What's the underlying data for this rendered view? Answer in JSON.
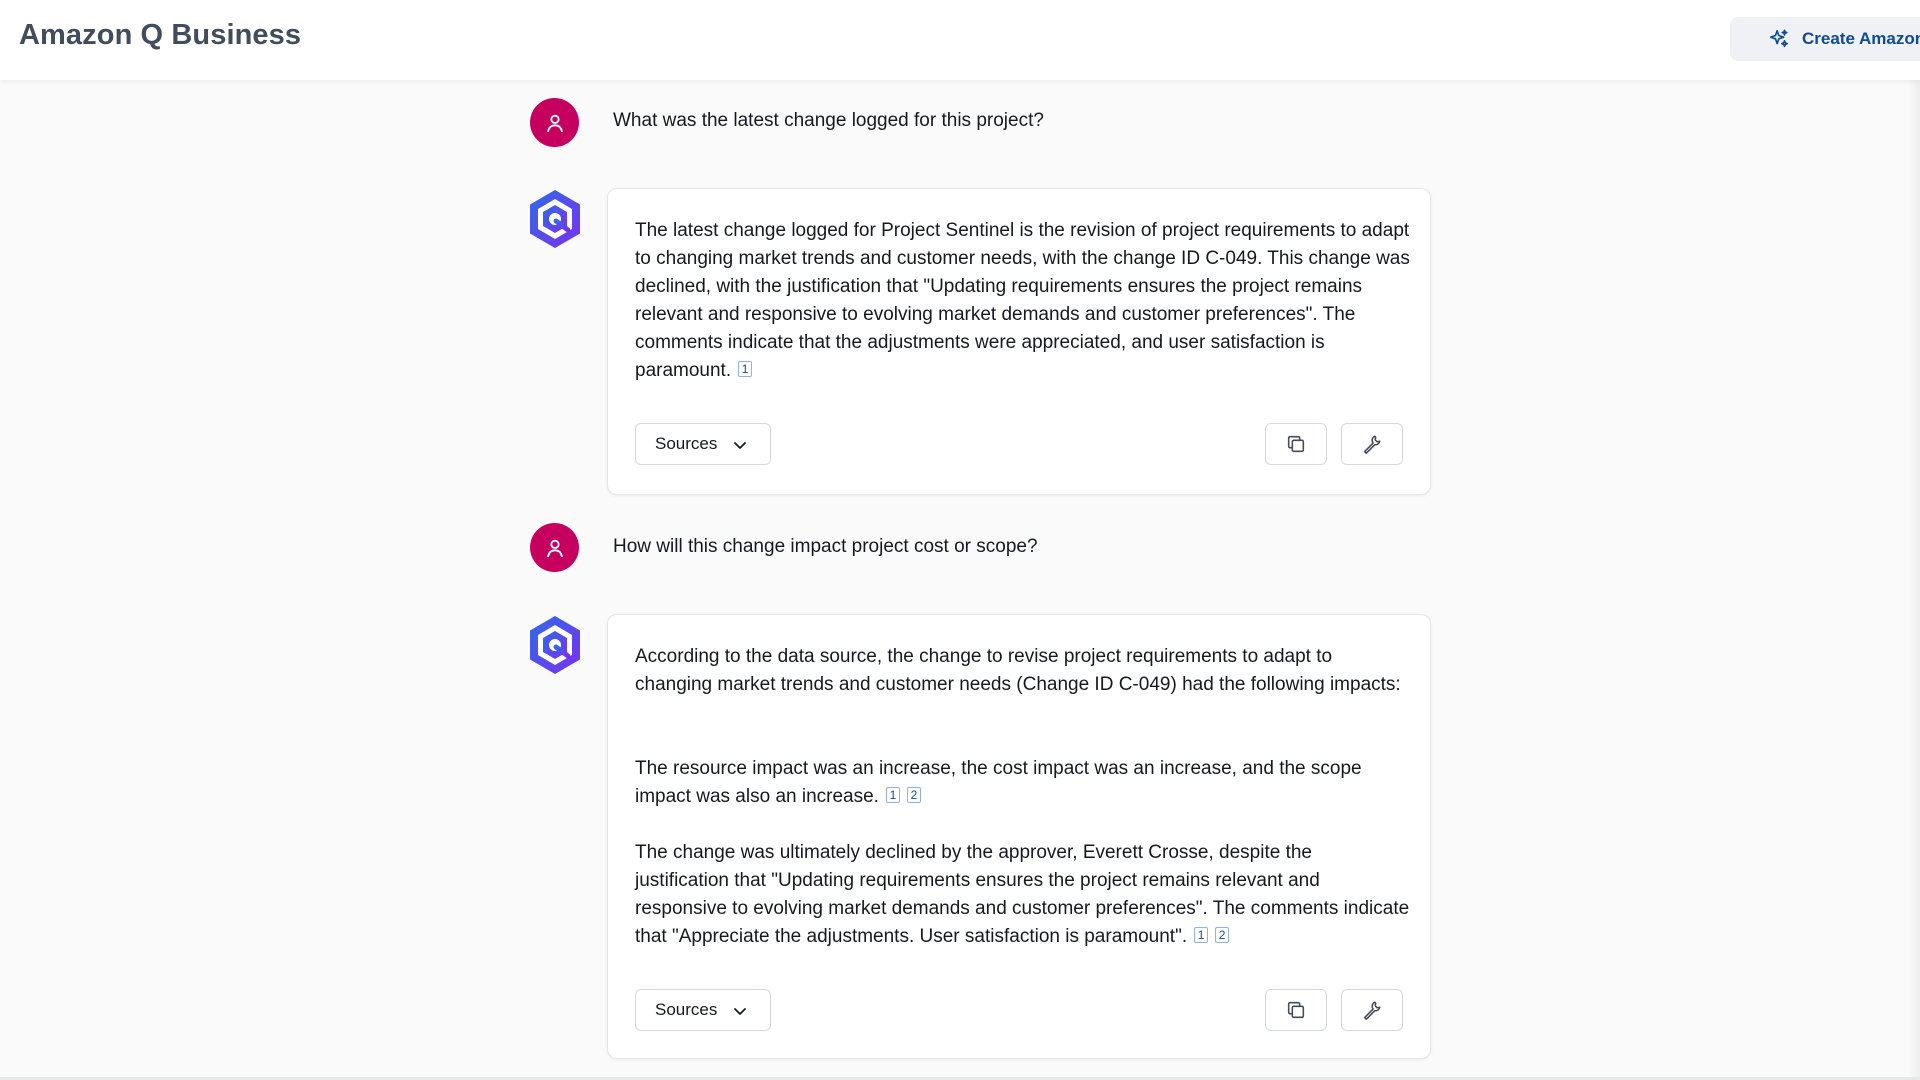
{
  "header": {
    "title": "Amazon Q Business",
    "create_button_label": "Create Amazon"
  },
  "conversation": [
    {
      "question": "What was the latest change logged for this project?",
      "answer_paragraphs": [
        {
          "text": "The latest change logged for Project Sentinel is the revision of project requirements to adapt to changing market trends and customer needs, with the change ID C-049. This change was declined, with the justification that \"Updating requirements ensures the project remains relevant and responsive to evolving market demands and customer preferences\". The comments indicate that the adjustments were appreciated, and user satisfaction is paramount.",
          "citations": [
            "1"
          ]
        }
      ],
      "sources_label": "Sources"
    },
    {
      "question": "How will this change impact project cost or scope?",
      "answer_paragraphs": [
        {
          "text": "According to the data source, the change to revise project requirements to adapt to changing market trends and customer needs (Change ID C-049) had the following impacts:",
          "citations": []
        },
        {
          "text": "The resource impact was an increase, the cost impact was an increase, and the scope impact was also an increase.",
          "citations": [
            "1",
            "2"
          ]
        },
        {
          "text": "The change was ultimately declined by the approver, Everett Crosse, despite the justification that \"Updating requirements ensures the project remains relevant and responsive to evolving market demands and customer preferences\". The comments indicate that \"Appreciate the adjustments. User satisfaction is paramount\".",
          "citations": [
            "1",
            "2"
          ]
        }
      ],
      "sources_label": "Sources"
    }
  ],
  "icons": {
    "user_avatar": "person-icon",
    "assistant_avatar": "amazon-q-logo-icon",
    "create_button": "sparkle-icon",
    "sources_toggle": "chevron-down-icon",
    "copy": "copy-icon",
    "feedback": "wrench-icon"
  },
  "colors": {
    "user_avatar_bg": "#c5005f",
    "brand_gradient_start": "#2f6be8",
    "brand_gradient_end": "#7b2ff0",
    "link": "#0f4a99"
  }
}
